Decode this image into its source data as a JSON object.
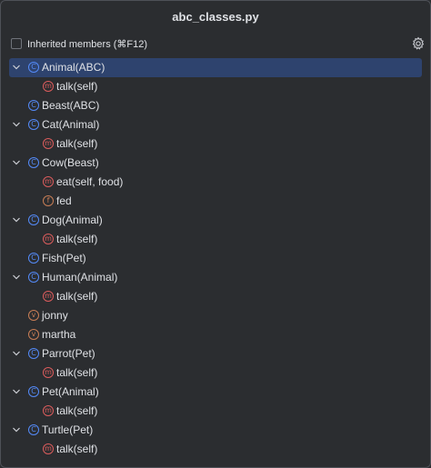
{
  "window": {
    "title": "abc_classes.py"
  },
  "toolbar": {
    "inherited_label": "Inherited members (⌘F12)",
    "settings_icon": "gear-icon"
  },
  "tree": [
    {
      "label": "Animal(ABC)",
      "kind": "c",
      "depth": 0,
      "expandable": true,
      "selected": true
    },
    {
      "label": "talk(self)",
      "kind": "m",
      "depth": 1,
      "expandable": false
    },
    {
      "label": "Beast(ABC)",
      "kind": "c",
      "depth": 0,
      "expandable": false
    },
    {
      "label": "Cat(Animal)",
      "kind": "c",
      "depth": 0,
      "expandable": true
    },
    {
      "label": "talk(self)",
      "kind": "m",
      "depth": 1,
      "expandable": false
    },
    {
      "label": "Cow(Beast)",
      "kind": "c",
      "depth": 0,
      "expandable": true
    },
    {
      "label": "eat(self, food)",
      "kind": "m",
      "depth": 1,
      "expandable": false
    },
    {
      "label": "fed",
      "kind": "f",
      "depth": 1,
      "expandable": false
    },
    {
      "label": "Dog(Animal)",
      "kind": "c",
      "depth": 0,
      "expandable": true
    },
    {
      "label": "talk(self)",
      "kind": "m",
      "depth": 1,
      "expandable": false
    },
    {
      "label": "Fish(Pet)",
      "kind": "c",
      "depth": 0,
      "expandable": false
    },
    {
      "label": "Human(Animal)",
      "kind": "c",
      "depth": 0,
      "expandable": true
    },
    {
      "label": "talk(self)",
      "kind": "m",
      "depth": 1,
      "expandable": false
    },
    {
      "label": "jonny",
      "kind": "v",
      "depth": 0,
      "expandable": false
    },
    {
      "label": "martha",
      "kind": "v",
      "depth": 0,
      "expandable": false
    },
    {
      "label": "Parrot(Pet)",
      "kind": "c",
      "depth": 0,
      "expandable": true
    },
    {
      "label": "talk(self)",
      "kind": "m",
      "depth": 1,
      "expandable": false
    },
    {
      "label": "Pet(Animal)",
      "kind": "c",
      "depth": 0,
      "expandable": true
    },
    {
      "label": "talk(self)",
      "kind": "m",
      "depth": 1,
      "expandable": false
    },
    {
      "label": "Turtle(Pet)",
      "kind": "c",
      "depth": 0,
      "expandable": true
    },
    {
      "label": "talk(self)",
      "kind": "m",
      "depth": 1,
      "expandable": false
    }
  ],
  "badge_letters": {
    "c": "C",
    "m": "m",
    "f": "f",
    "v": "v"
  },
  "colors": {
    "class_badge": "#548af7",
    "method_badge": "#db5c5c",
    "field_badge": "#c77d55",
    "selection": "#2e436e",
    "background": "#2b2d30"
  }
}
